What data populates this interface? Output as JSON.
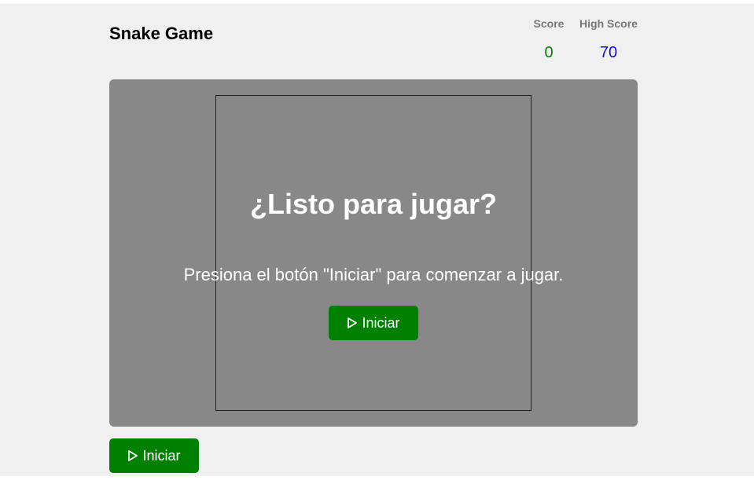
{
  "header": {
    "title": "Snake Game",
    "score_label": "Score",
    "score_value": "0",
    "high_score_label": "High Score",
    "high_score_value": "70"
  },
  "overlay": {
    "title": "¿Listo para jugar?",
    "message": "Presiona el botón \"Iniciar\" para comenzar a jugar.",
    "start_label": "Iniciar",
    "start_icon": "play-icon"
  },
  "controls": {
    "start_label": "Iniciar",
    "start_icon": "play-icon"
  },
  "colors": {
    "button": "#008000",
    "score": "#0a7a0a",
    "high_score": "#1010c8",
    "background": "#f0f0f0"
  }
}
